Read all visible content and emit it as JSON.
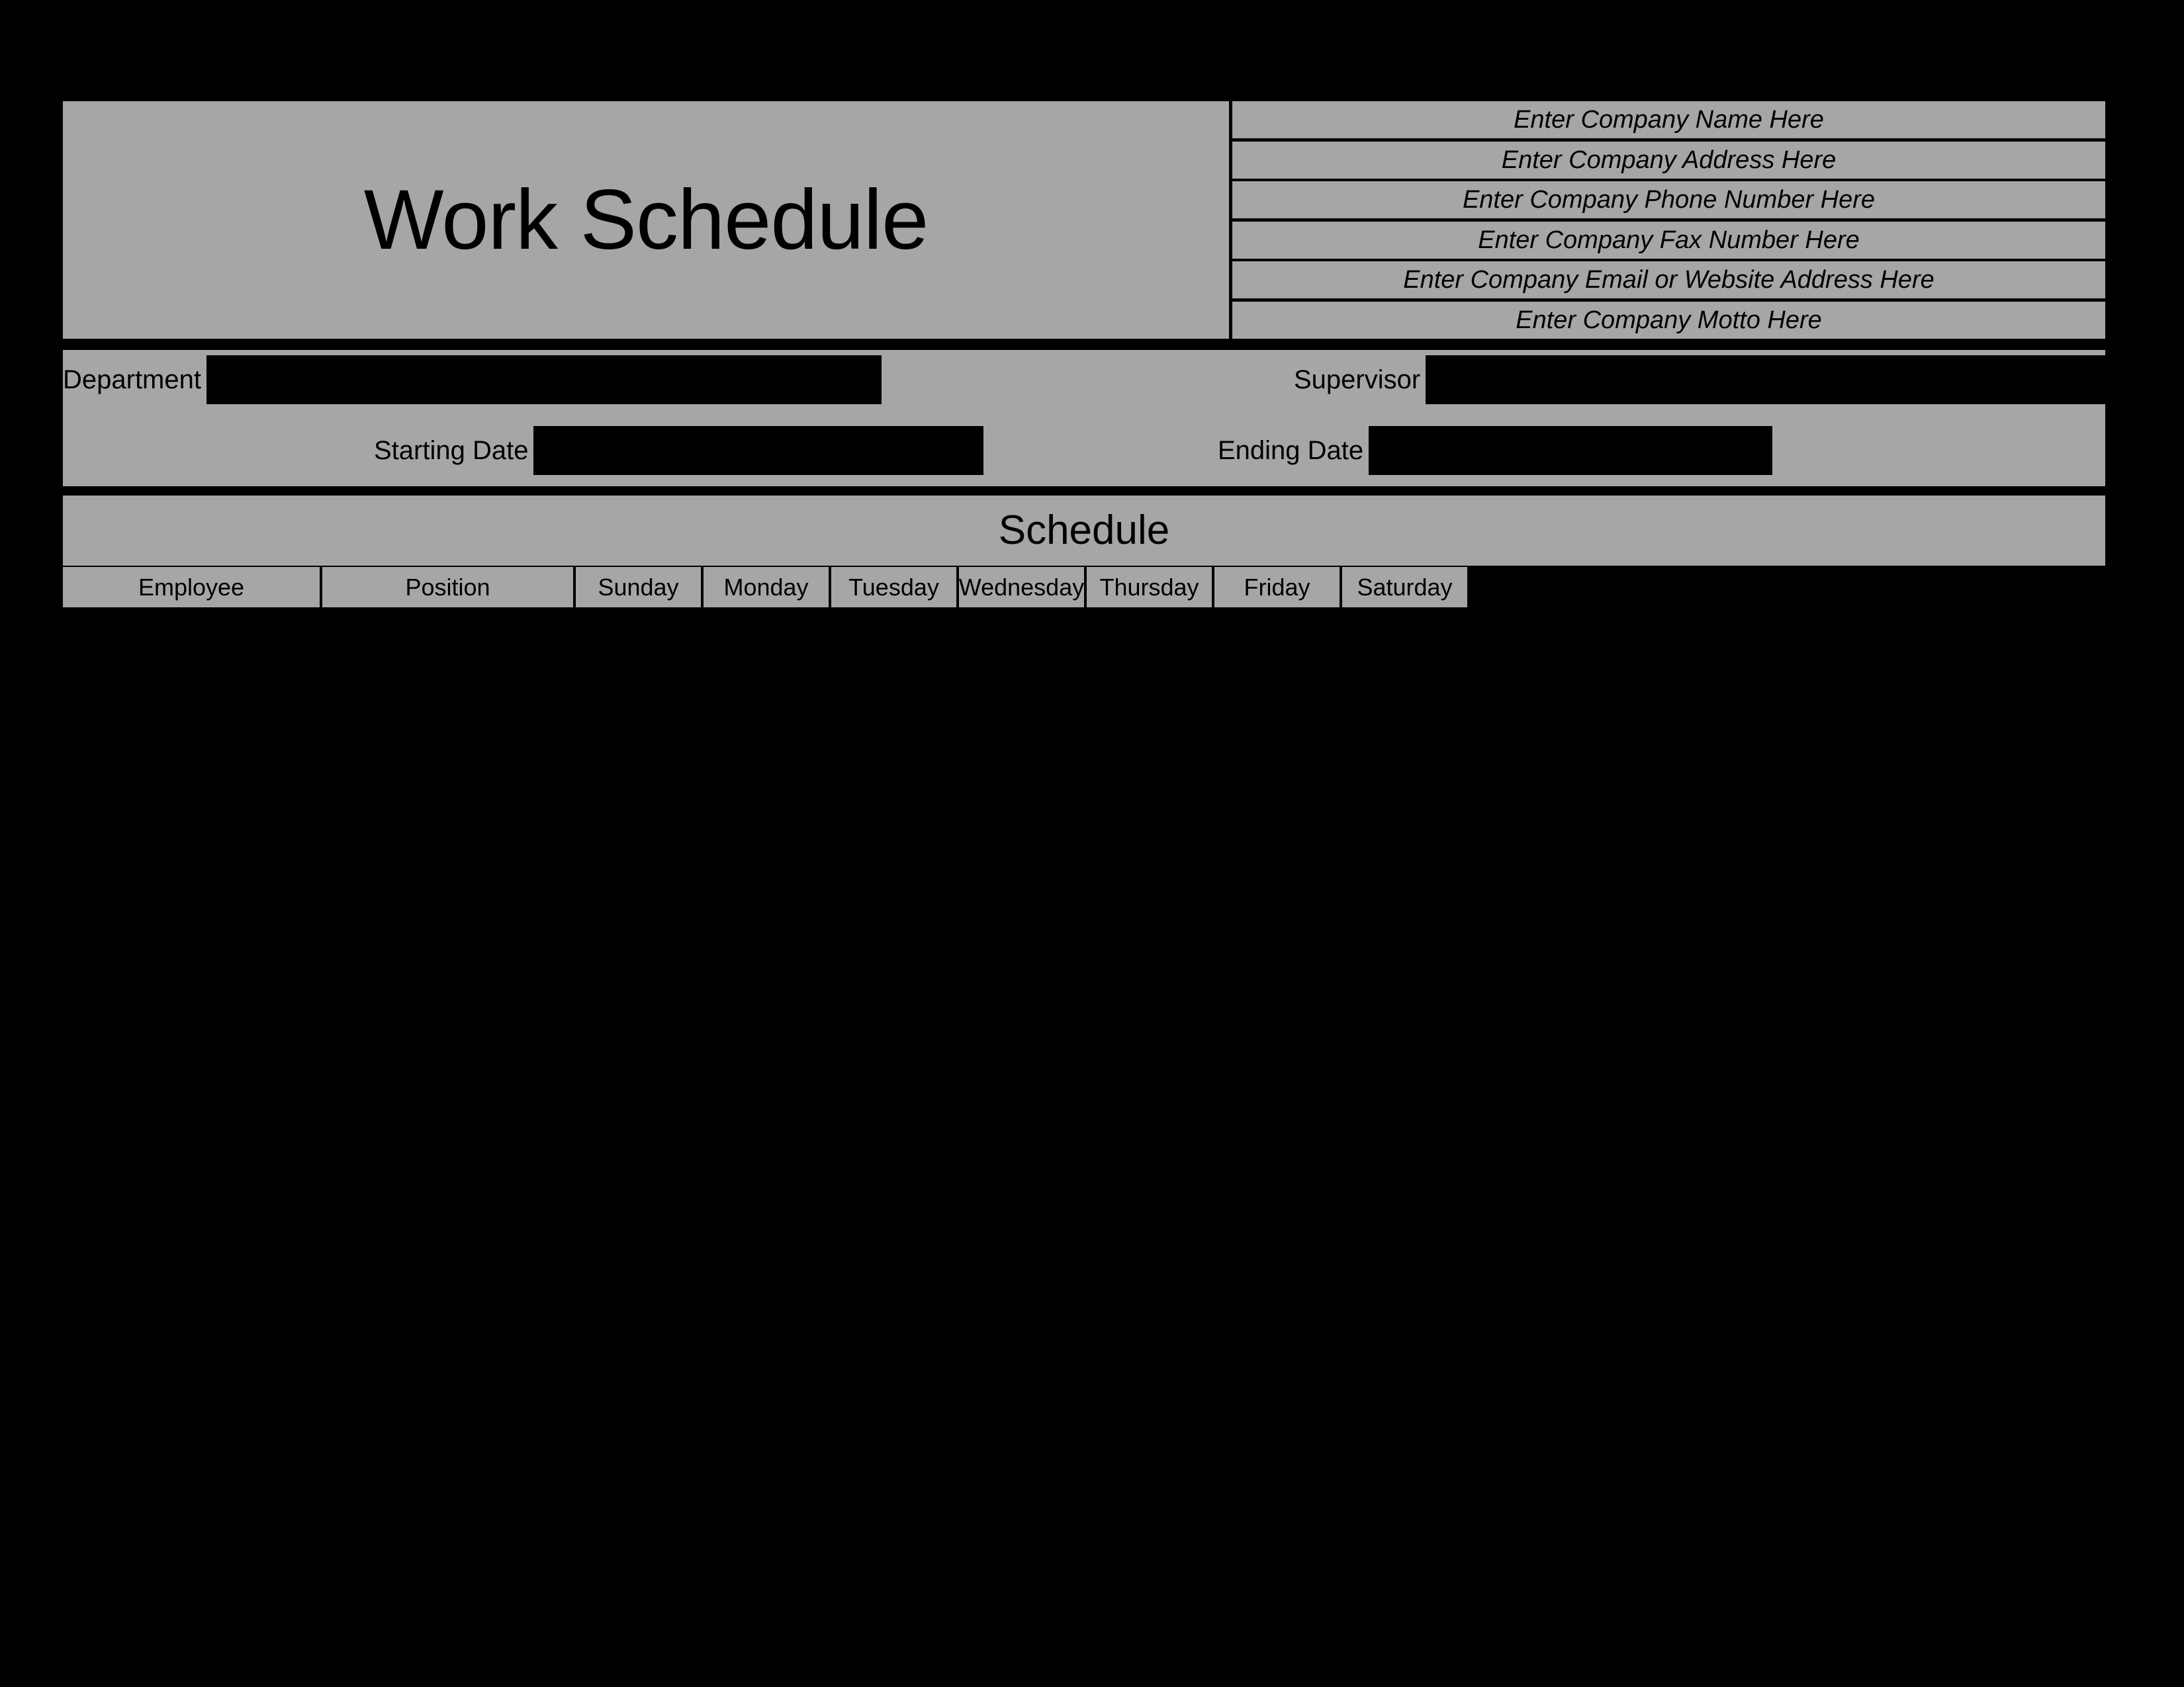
{
  "document": {
    "title": "Work Schedule",
    "background_color": "#000000",
    "panel_color": "#a6a6a6",
    "text_color": "#000000"
  },
  "company_info": {
    "rows": [
      {
        "placeholder": "Enter Company Name Here"
      },
      {
        "placeholder": "Enter Company Address Here"
      },
      {
        "placeholder": "Enter Company Phone Number Here"
      },
      {
        "placeholder": "Enter Company Fax Number Here"
      },
      {
        "placeholder": "Enter Company Email or Website Address Here"
      },
      {
        "placeholder": "Enter Company Motto Here"
      }
    ]
  },
  "info_fields": {
    "department": {
      "label": "Department",
      "value": ""
    },
    "supervisor": {
      "label": "Supervisor",
      "value": ""
    },
    "starting_date": {
      "label": "Starting Date",
      "value": ""
    },
    "ending_date": {
      "label": "Ending Date",
      "value": ""
    }
  },
  "schedule": {
    "section_title": "Schedule",
    "columns": [
      {
        "label": "Employee"
      },
      {
        "label": "Position"
      },
      {
        "label": "Sunday"
      },
      {
        "label": "Monday"
      },
      {
        "label": "Tuesday"
      },
      {
        "label": "Wednesday"
      },
      {
        "label": "Thursday"
      },
      {
        "label": "Friday"
      },
      {
        "label": "Saturday"
      }
    ],
    "rows": []
  }
}
